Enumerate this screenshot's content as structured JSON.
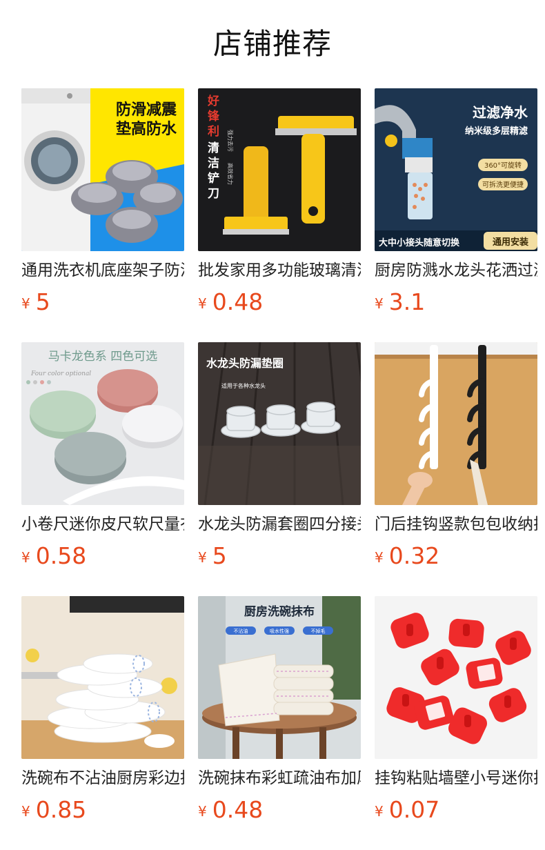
{
  "page": {
    "title": "店铺推荐"
  },
  "currency": "¥",
  "products": [
    {
      "name": "通用洗衣机底座架子防滑减震垫",
      "price": "5",
      "image_text": [
        "防滑减震",
        "垫高防水"
      ]
    },
    {
      "name": "批发家用多功能玻璃清洁铲刀",
      "price": "0.48",
      "image_text": [
        "好",
        "锋",
        "利",
        "清",
        "洁",
        "铲",
        "刀",
        "强力去污",
        "高效省力"
      ]
    },
    {
      "name": "厨房防溅水龙头花洒过滤器",
      "price": "3.1",
      "image_text": [
        "过滤净水",
        "纳米级多层精滤",
        "360°可旋转",
        "可拆洗更便捷",
        "大中小接头随意切换",
        "通用安装"
      ]
    },
    {
      "name": "小卷尺迷你皮尺软尺量衣尺",
      "price": "0.58",
      "image_text": [
        "马卡龙色系  四色可选",
        "Four color optional"
      ]
    },
    {
      "name": "水龙头防漏套圈四分接头垫圈",
      "price": "5",
      "image_text": [
        "水龙头防漏垫圈",
        "适用于各种水龙头"
      ]
    },
    {
      "name": "门后挂钩竖款包包收纳挂架",
      "price": "0.32",
      "image_text": []
    },
    {
      "name": "洗碗布不沾油厨房彩边抹布",
      "price": "0.85",
      "image_text": []
    },
    {
      "name": "洗碗抹布彩虹疏油布加厚",
      "price": "0.48",
      "image_text": [
        "厨房洗碗抹布",
        "不沾油",
        "吸水性强",
        "不掉毛"
      ]
    },
    {
      "name": "挂钩粘贴墙壁小号迷你挂钩",
      "price": "0.07",
      "image_text": []
    }
  ],
  "colors": {
    "price": "#e8491d",
    "title": "#111111"
  }
}
